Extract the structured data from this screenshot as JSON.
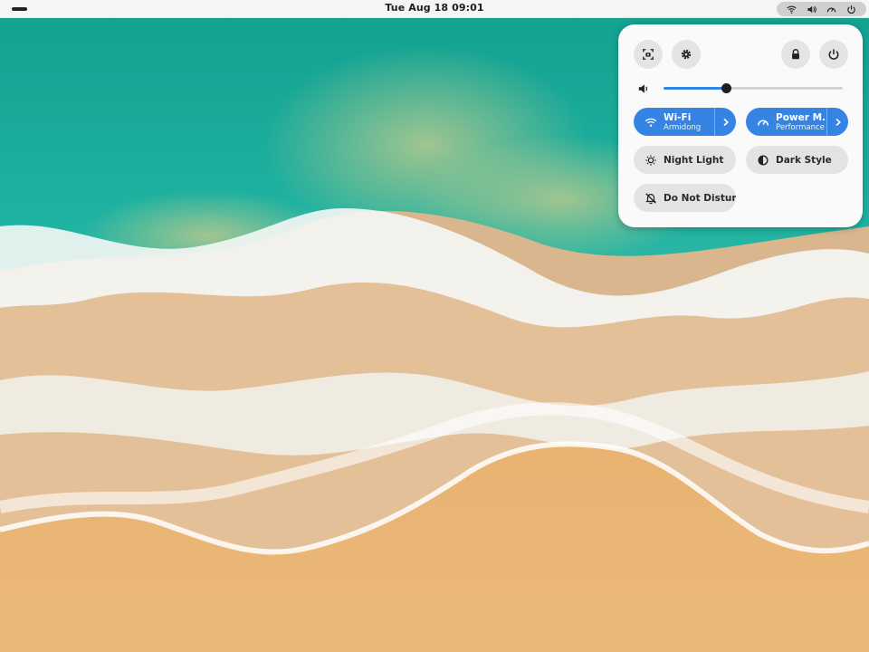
{
  "top_bar": {
    "clock": "Tue Aug 18  09:01",
    "system_icons": [
      "wifi-icon",
      "volume-icon",
      "power-mode-icon",
      "power-icon"
    ]
  },
  "quick_settings": {
    "top_buttons": [
      "screenshot-icon",
      "settings-icon",
      "lock-icon",
      "power-icon"
    ],
    "volume": {
      "level": 0.35
    },
    "toggles": {
      "wifi": {
        "title": "Wi-Fi",
        "subtitle": "Armidong",
        "active": true
      },
      "power_mode": {
        "title": "Power M...",
        "subtitle": "Performance",
        "active": true
      },
      "night_light": {
        "title": "Night Light",
        "active": false
      },
      "dark_style": {
        "title": "Dark Style",
        "active": false
      },
      "do_not_disturb": {
        "title": "Do Not Disturb",
        "active": false
      }
    }
  },
  "colors": {
    "accent": "#3584e4",
    "panel_bg": "#fafafa",
    "ocean": "#1aa99a",
    "sand": "#e9b676"
  }
}
